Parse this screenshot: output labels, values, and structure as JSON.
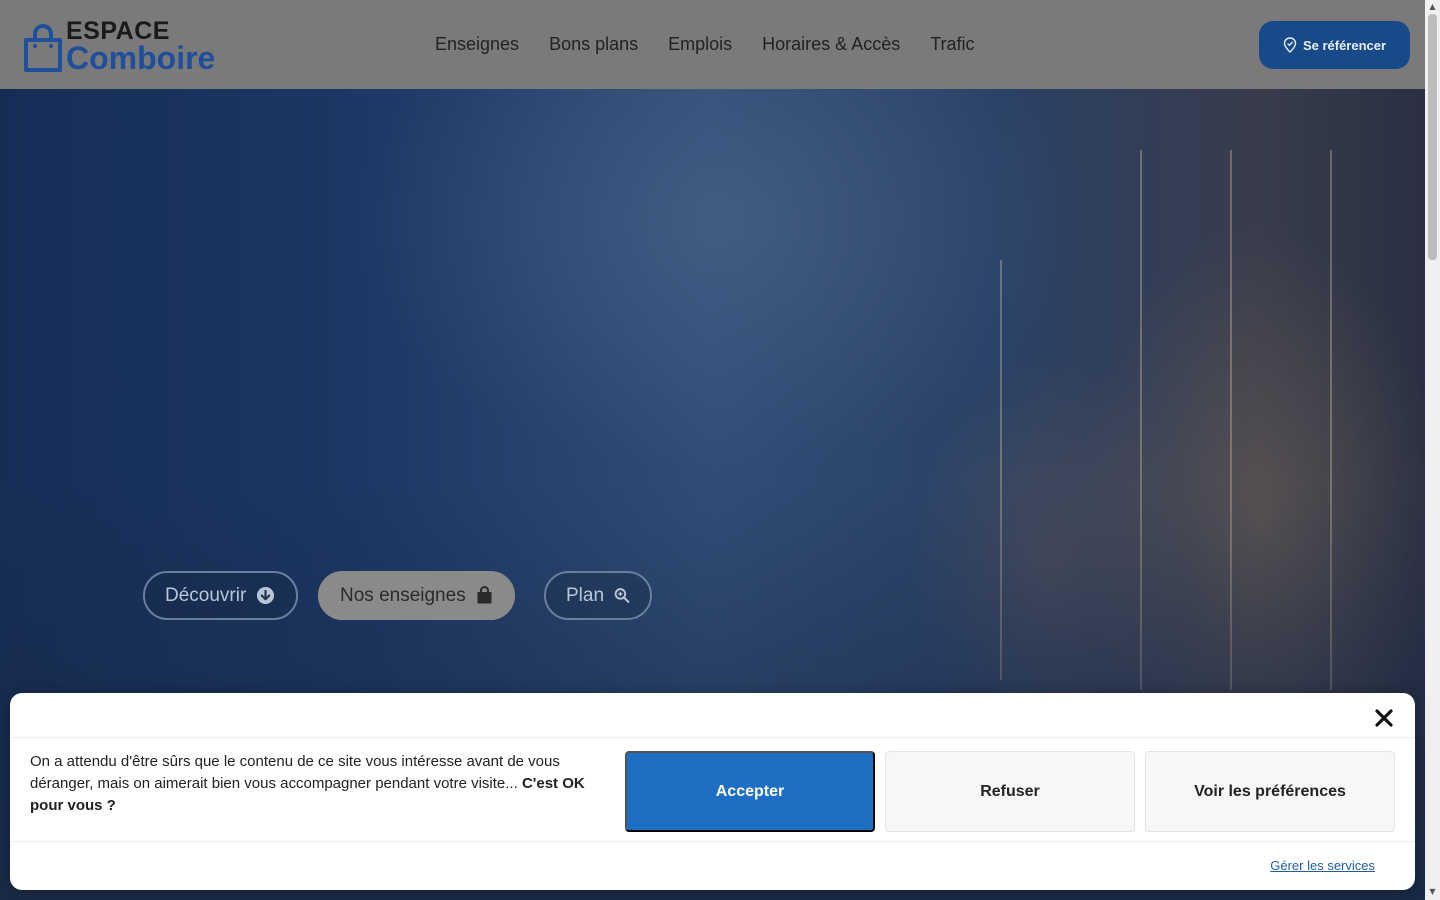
{
  "header": {
    "logo": {
      "line1": "ESPACE",
      "line2": "Comboire"
    },
    "nav": [
      {
        "label": "Enseignes"
      },
      {
        "label": "Bons plans"
      },
      {
        "label": "Emplois"
      },
      {
        "label": "Horaires & Accès"
      },
      {
        "label": "Trafic"
      }
    ],
    "cta_label": "Se référencer"
  },
  "hero": {
    "buttons": [
      {
        "label": "Découvrir",
        "icon": "arrow-down-circle-icon"
      },
      {
        "label": "Nos enseignes",
        "icon": "shopping-bag-icon"
      },
      {
        "label": "Plan",
        "icon": "magnifier-icon"
      }
    ]
  },
  "cookie": {
    "text": "On a attendu d'être sûrs que le contenu de ce site vous intéresse avant de vous déranger, mais on aimerait bien vous accompagner pendant votre visite...",
    "text_bold": "C'est OK pour vous ?",
    "accept_label": "Accepter",
    "refuse_label": "Refuser",
    "prefs_label": "Voir les préférences",
    "manage_label": "Gérer les services"
  },
  "colors": {
    "brand_blue": "#184a8a",
    "accept_blue": "#1e6fc3",
    "logo_blue": "#1f4f9a"
  }
}
